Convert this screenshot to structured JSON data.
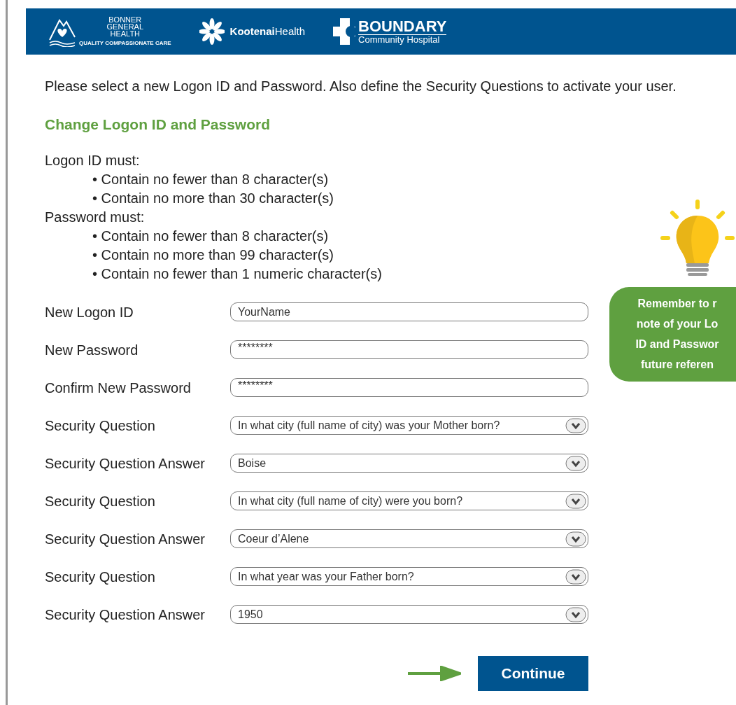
{
  "header": {
    "logos": [
      {
        "kind": "bonner",
        "lines": [
          "BONNER",
          "GENERAL",
          "HEALTH"
        ],
        "tagline": "QUALITY COMPASSIONATE CARE"
      },
      {
        "kind": "kootenai",
        "bold": "Kootenai",
        "light": "Health"
      },
      {
        "kind": "boundary",
        "title": "BOUNDARY",
        "subtitle": "Community Hospital"
      }
    ]
  },
  "intro": "Please select a new Logon ID and Password. Also define the Security Questions to activate your user.",
  "heading": "Change Logon ID and Password",
  "requirements": [
    {
      "title": "Logon ID must:",
      "items": [
        "• Contain no fewer than 8 character(s)",
        "• Contain no more than 30 character(s)"
      ]
    },
    {
      "title": "Password must:",
      "items": [
        "• Contain no fewer than 8 character(s)",
        "• Contain no more than 99 character(s)",
        "• Contain no fewer than 1 numeric character(s)"
      ]
    }
  ],
  "fields": [
    {
      "label": "New Logon ID",
      "kind": "text",
      "value": "YourName"
    },
    {
      "label": "New Password",
      "kind": "password",
      "value": "********"
    },
    {
      "label": "Confirm New Password",
      "kind": "password",
      "value": "********"
    },
    {
      "label": "Security Question",
      "kind": "dropdown",
      "value": "In what city (full name of city) was your Mother born?"
    },
    {
      "label": "Security Question Answer",
      "kind": "dropdown",
      "value": "Boise"
    },
    {
      "label": "Security Question",
      "kind": "dropdown",
      "value": "In what city (full name of city) were you born?"
    },
    {
      "label": "Security Question Answer",
      "kind": "dropdown",
      "value": "Coeur d’Alene"
    },
    {
      "label": "Security Question",
      "kind": "dropdown",
      "value": "In what year was your Father born?"
    },
    {
      "label": "Security Question Answer",
      "kind": "dropdown",
      "value": "1950"
    }
  ],
  "note": {
    "lines": [
      "Remember to r",
      "note of your Lo",
      "ID and Passwor",
      "future referen"
    ]
  },
  "continue_button": "Continue"
}
